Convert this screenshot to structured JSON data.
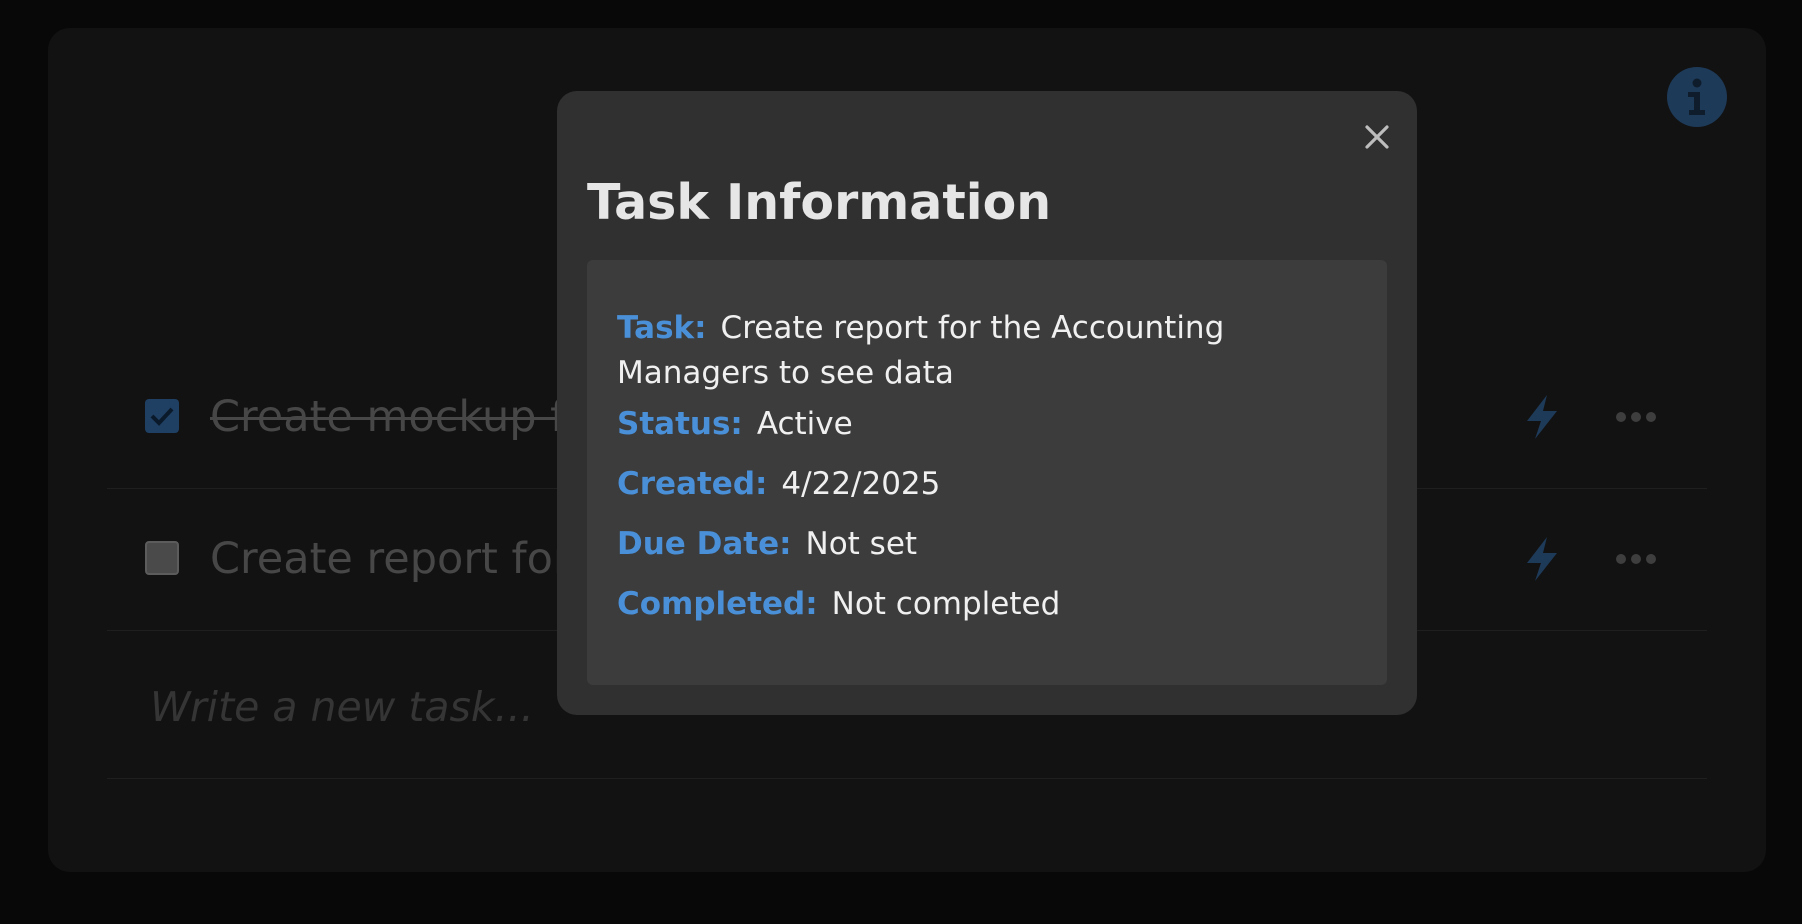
{
  "info_button": {
    "icon": "info-icon"
  },
  "tasks": [
    {
      "text": "Create mockup fo",
      "checked": true
    },
    {
      "text": "Create report for t",
      "checked": false
    }
  ],
  "new_task": {
    "placeholder": "Write a new task..."
  },
  "modal": {
    "title": "Task Information",
    "close_icon": "close-icon",
    "fields": {
      "task_label": "Task:",
      "task_value": "Create report for the Accounting Managers to see data",
      "status_label": "Status:",
      "status_value": "Active",
      "created_label": "Created:",
      "created_value": "4/22/2025",
      "due_label": "Due Date:",
      "due_value": "Not set",
      "completed_label": "Completed:",
      "completed_value": "Not completed"
    }
  },
  "colors": {
    "accent": "#4a90d9",
    "modal_bg": "#303030",
    "panel_bg": "#3c3c3c",
    "page_bg": "#080808"
  }
}
